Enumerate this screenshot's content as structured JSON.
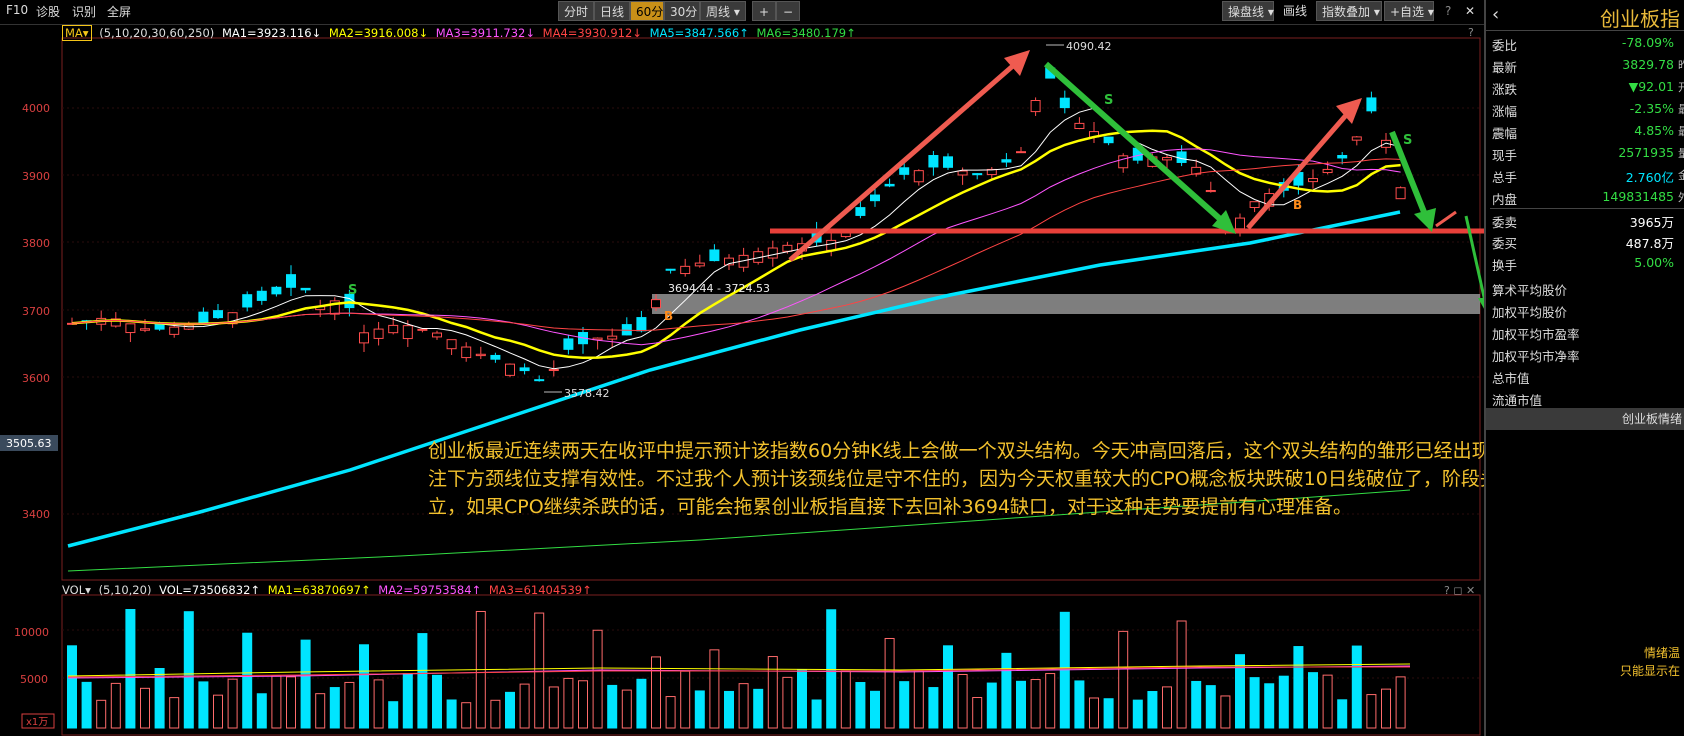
{
  "toolbar": {
    "left_items": [
      "F10",
      "诊股",
      "识别",
      "全屏"
    ],
    "period_tabs": [
      {
        "label": "分时",
        "active": false
      },
      {
        "label": "日线",
        "active": false
      },
      {
        "label": "60分",
        "active": true
      },
      {
        "label": "30分",
        "active": false
      },
      {
        "label": "周线 ▾",
        "active": false
      }
    ],
    "zoom_in": "+",
    "zoom_out": "−",
    "right_items": [
      "操盘线 ▾",
      "画线",
      "指数叠加 ▾",
      "+自选 ▾"
    ],
    "help": "?",
    "close": "✕"
  },
  "ma_header": {
    "indicator": "MA▾",
    "params": "(5,10,20,30,60,250)",
    "items": [
      {
        "text": "MA1=3923.116↓",
        "color": "#ffffff"
      },
      {
        "text": "MA2=3916.008↓",
        "color": "#ffff00"
      },
      {
        "text": "MA3=3911.732↓",
        "color": "#ff55ff"
      },
      {
        "text": "MA4=3930.912↓",
        "color": "#ff4444"
      },
      {
        "text": "MA5=3847.566↑",
        "color": "#00e5ff"
      },
      {
        "text": "MA6=3480.179↑",
        "color": "#33dd44"
      }
    ]
  },
  "price_axis": [
    "4000",
    "3900",
    "3800",
    "3700",
    "3600",
    "3400"
  ],
  "current_price_label": "3505.63",
  "price_annotations": {
    "high": "4090.42",
    "low": "3578.42",
    "gap": "3694.44 - 3724.53"
  },
  "signals": {
    "sell": "S",
    "buy": "B"
  },
  "annotation_text": "创业板最近连续两天在收评中提示预计该指数60分钟K线上会做一个双头结构。今天冲高回落后，这个双头结构的雏形已经出现了，明天先关注下方颈线位支撑有效性。不过我个人预计该颈线位是守不住的，因为今天权重较大的CPO概念板块跌破10日线破位了，阶段头部很可能成立，如果CPO继续杀跌的话，可能会拖累创业板指直接下去回补3694缺口，对于这种走势要提前有心理准备。",
  "vol_header": {
    "indicator": "VOL▾",
    "params": "(5,10,20)",
    "items": [
      {
        "text": "VOL=73506832↑",
        "color": "#ffffff"
      },
      {
        "text": "MA1=63870697↑",
        "color": "#ffff00"
      },
      {
        "text": "MA2=59753584↑",
        "color": "#ff55ff"
      },
      {
        "text": "MA3=61404539↑",
        "color": "#ff4444"
      }
    ]
  },
  "vol_axis": [
    "10000",
    "5000"
  ],
  "vol_unit": "x1万",
  "right_panel": {
    "title": "创业板指",
    "back": "‹",
    "rows": [
      {
        "k": "委比",
        "v": "-78.09%",
        "color": "#33dd44",
        "sfx": ""
      },
      {
        "k": "最新",
        "v": "3829.78",
        "color": "#33dd44",
        "sfx": "昨"
      },
      {
        "k": "涨跌",
        "v": "▼92.01",
        "color": "#33dd44",
        "sfx": "开"
      },
      {
        "k": "涨幅",
        "v": "-2.35%",
        "color": "#33dd44",
        "sfx": "最"
      },
      {
        "k": "震幅",
        "v": "4.85%",
        "color": "#33dd44",
        "sfx": "最"
      },
      {
        "k": "现手",
        "v": "2571935",
        "color": "#33dd44",
        "sfx": "量"
      },
      {
        "k": "总手",
        "v": "2.760亿",
        "color": "#00e5ff",
        "sfx": "金"
      },
      {
        "k": "内盘",
        "v": "149831485",
        "color": "#33dd44",
        "sfx": "外"
      },
      {
        "k": "委卖",
        "v": "3965万",
        "color": "#ffffff",
        "sfx": ""
      },
      {
        "k": "委买",
        "v": "487.8万",
        "color": "#ffffff",
        "sfx": ""
      },
      {
        "k": "换手",
        "v": "5.00%",
        "color": "#33dd44",
        "sfx": ""
      }
    ],
    "links": [
      "算术平均股价",
      "加权平均股价",
      "加权平均市盈率",
      "加权平均市净率",
      "总市值",
      "流通市值"
    ],
    "sub_header": "创业板情绪",
    "footer1": "情绪温",
    "footer2": "只能显示在"
  }
}
